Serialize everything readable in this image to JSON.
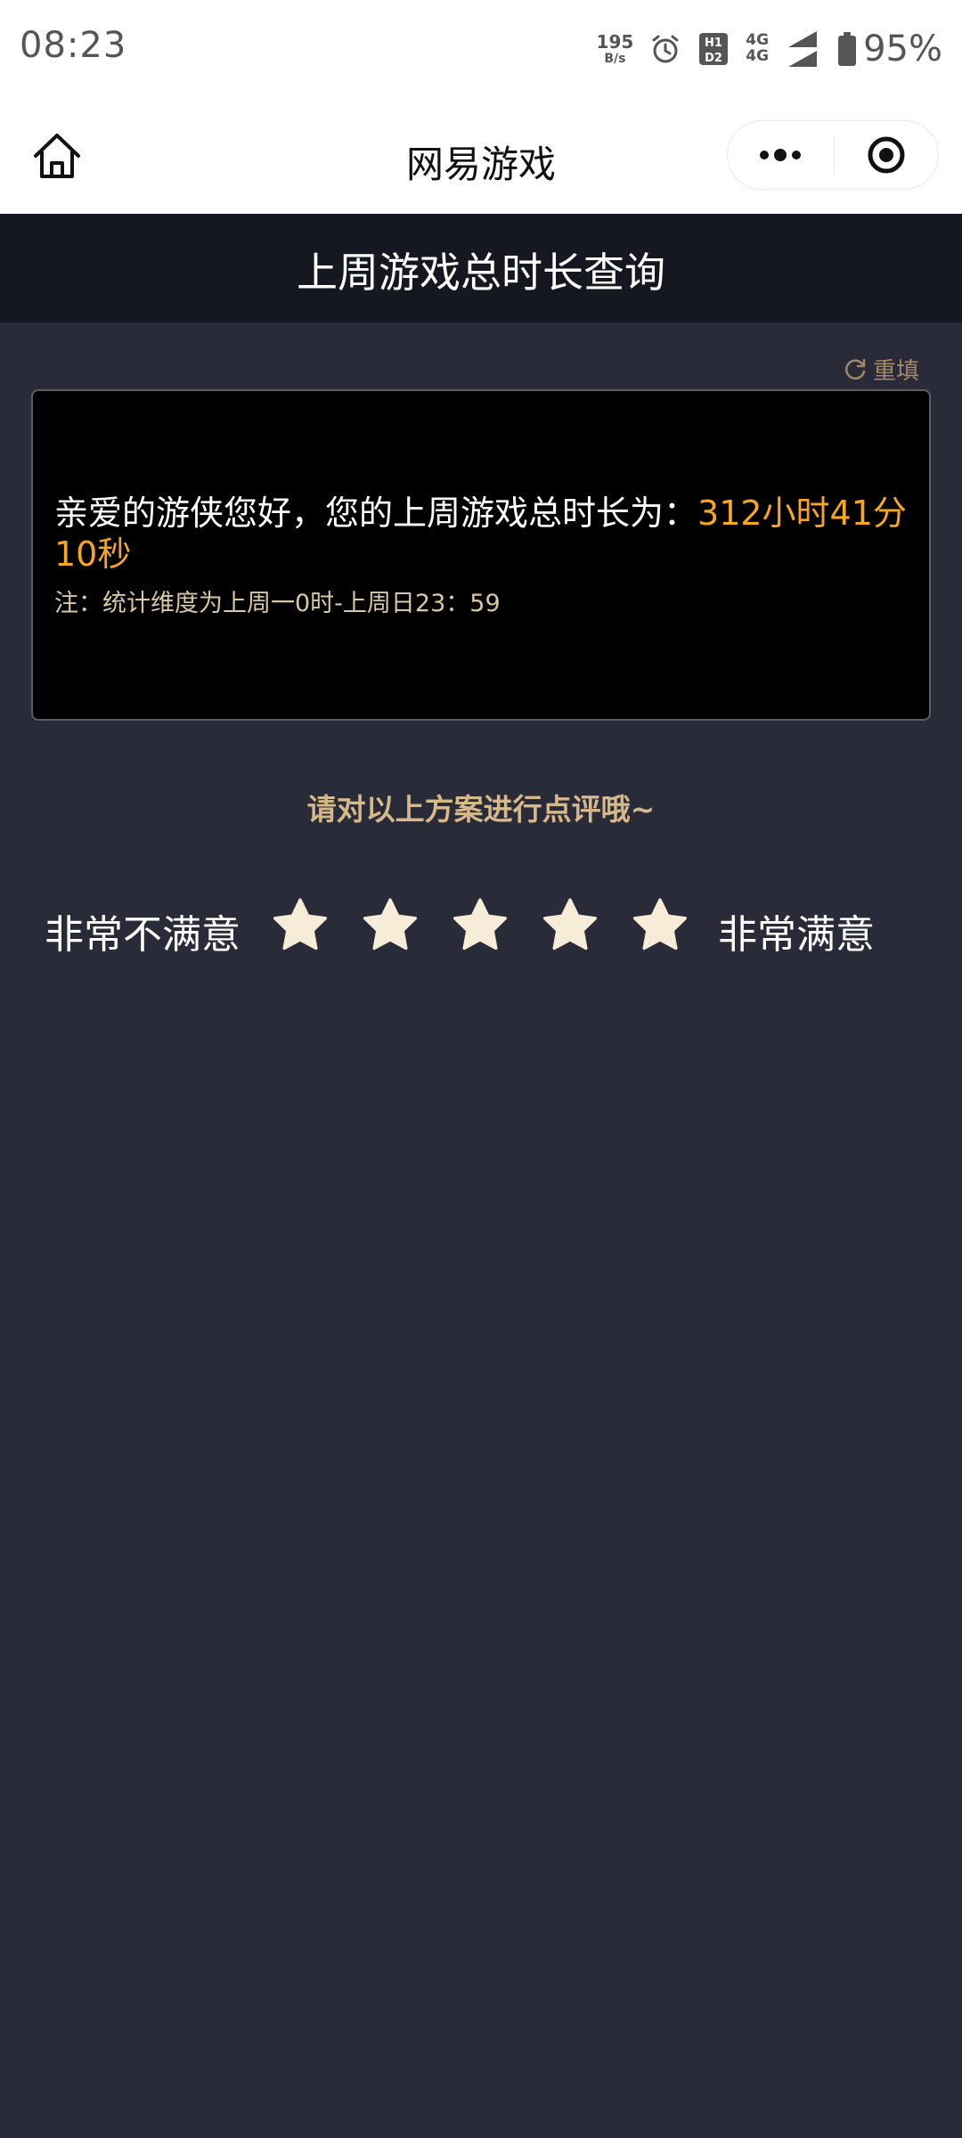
{
  "status_bar": {
    "time": "08:23",
    "net_speed_value": "195",
    "net_speed_unit": "B/s",
    "network_top": "4G",
    "network_bottom": "4G",
    "battery_percent": "95%",
    "icons": [
      "alarm-icon",
      "hd-icon",
      "signal-icon",
      "signal-icon",
      "battery-icon"
    ]
  },
  "nav": {
    "title": "网易游戏",
    "icons": [
      "home-icon",
      "more-icon",
      "close-target-icon"
    ]
  },
  "page": {
    "title": "上周游戏总时长查询"
  },
  "reset": {
    "label": "重填",
    "icon": "refresh-icon"
  },
  "result": {
    "prefix": "亲爱的游侠您好，您的上周游戏总时长为：",
    "value": "312小时41分10秒",
    "note": "注：统计维度为上周一0时-上周日23：59"
  },
  "rating": {
    "prompt": "请对以上方案进行点评哦~",
    "low_label": "非常不满意",
    "high_label": "非常满意",
    "star_count": 5,
    "selected": 0
  },
  "colors": {
    "background": "#292c38",
    "header": "#161821",
    "accent": "#f5a623",
    "gold": "#d6b98a",
    "star": "#f7ecd7"
  }
}
